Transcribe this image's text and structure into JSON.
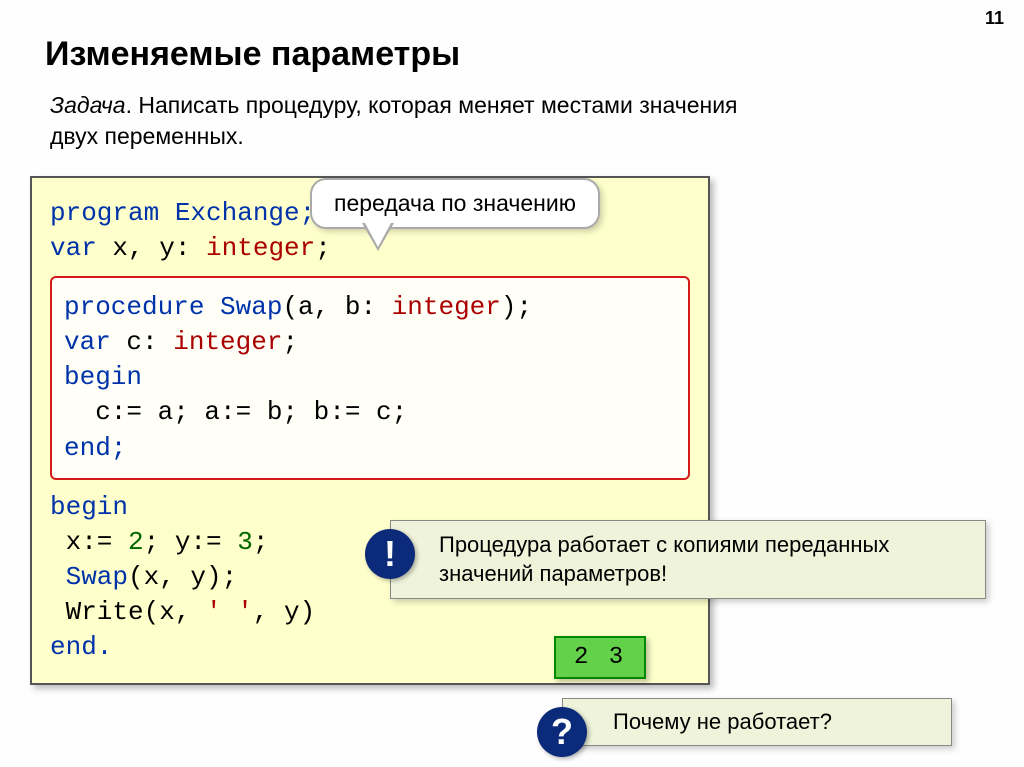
{
  "page_number": "11",
  "title": "Изменяемые параметры",
  "task_label": "Задача",
  "task_text": ". Написать процедуру, которая меняет местами значения двух переменных.",
  "callout_top": "передача по значению",
  "code": {
    "l1_kw": "program",
    "l1_name": " Exchange;",
    "l2_kw": "var",
    "l2_rest": " x, y: ",
    "l2_ty": "integer",
    "l2_end": ";",
    "p_kw": "procedure",
    "p_name": " Swap",
    "p_args_open": "(a, b: ",
    "p_ty": "integer",
    "p_args_close": ");",
    "p_var_kw": "var",
    "p_var_rest": " c: ",
    "p_var_ty": "integer",
    "p_var_end": ";",
    "p_begin": "begin",
    "p_body": "  c:= a; a:= b; b:= c;",
    "p_end": "end;",
    "m_begin": "begin",
    "m_assign1_pre": " x:= ",
    "m_assign1_n": "2",
    "m_assign_mid": "; y:= ",
    "m_assign2_n": "3",
    "m_assign_end": ";",
    "m_call_fn": " Swap",
    "m_call_args": "(x, y);",
    "m_write": " Write(x, ",
    "m_write_str": "' '",
    "m_write_end": ", y)",
    "m_end": "end."
  },
  "note_badge": "!",
  "note_text": "Процедура работает с копиями переданных значений параметров!",
  "output": "2 3",
  "question_badge": "?",
  "question_text": "Почему не работает?"
}
